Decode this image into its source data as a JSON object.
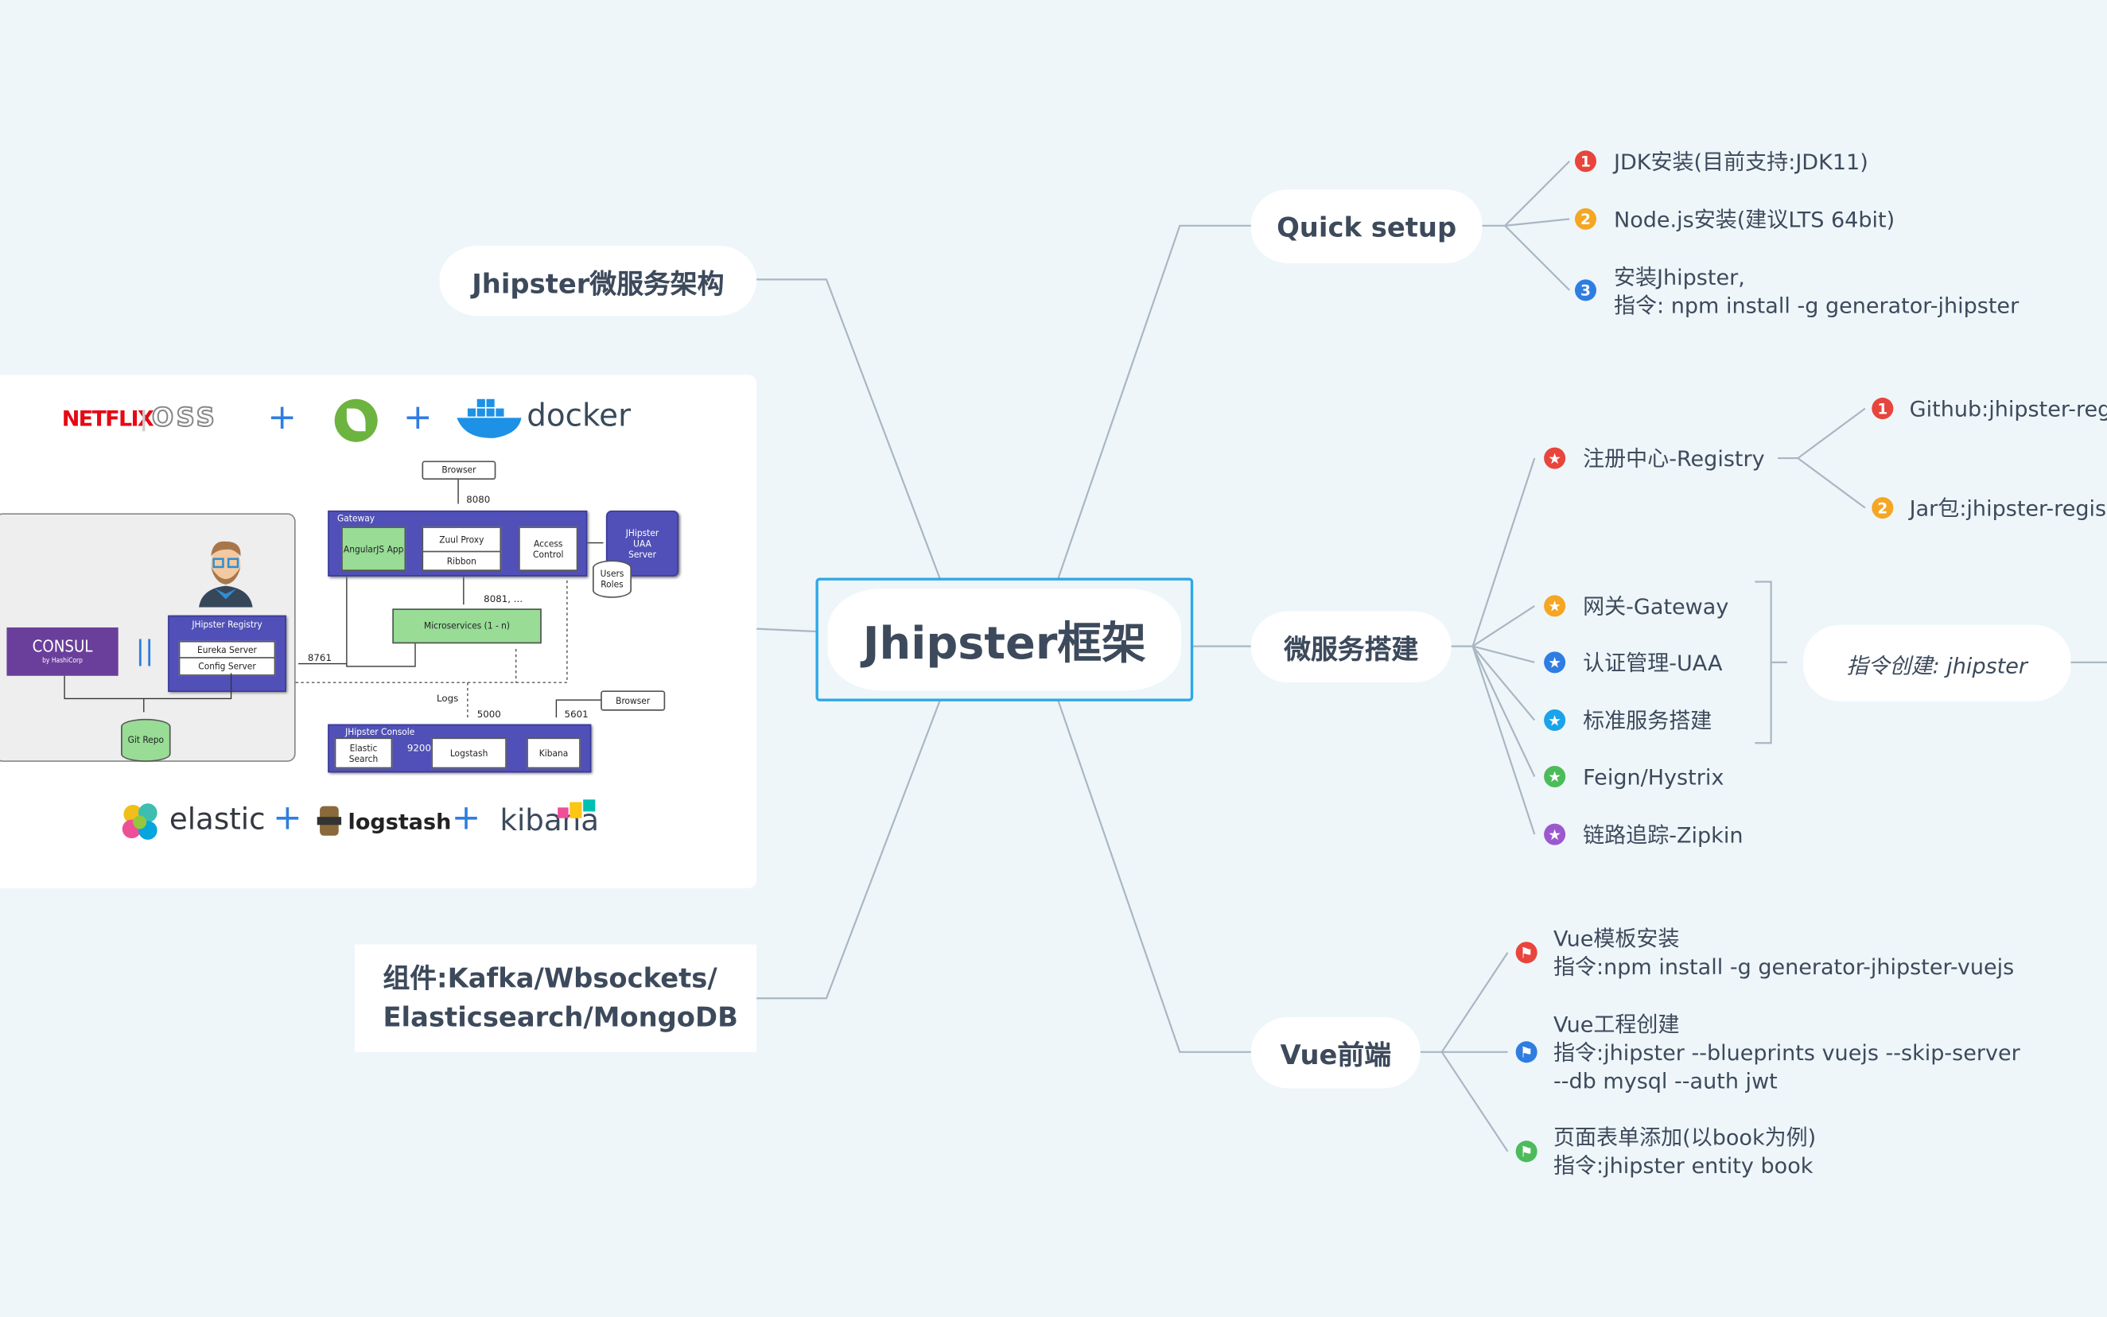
{
  "colors": {
    "background": "#eef6fa",
    "central_border": "#2ea8e6",
    "line": "#a9b7c3",
    "red": "#e8453c",
    "orange": "#f5a623",
    "blue": "#2f7de1",
    "cyan": "#1aa3e8",
    "green": "#4cbb5a",
    "purple": "#9b59d0",
    "diagram_blue": "#5050b8",
    "diagram_green": "#98dc96"
  },
  "central": {
    "title": "Jhipster框架"
  },
  "left": {
    "architecture": {
      "title": "Jhipster微服务架构"
    },
    "components": {
      "line1": "组件:Kafka/Wbsockets/",
      "line2": "Elasticsearch/MongoDB"
    }
  },
  "diagram": {
    "logos": {
      "netflix": "NETFLIX",
      "oss": "OSS",
      "docker": "docker",
      "elastic": "elastic",
      "logstash": "logstash",
      "kibana": "kibana",
      "consul": "CONSUL",
      "hashicorp": "by HashiCorp"
    },
    "browser": "Browser",
    "port_8080": "8080",
    "gateway": "Gateway",
    "angular": "AngularJS App",
    "zuul": "Zuul Proxy",
    "ribbon": "Ribbon",
    "access": "Access Control",
    "uaa": "JHipster UAA Server",
    "users_roles": "Users Roles",
    "port_8081": "8081, ...",
    "microservices": "Microservices  (1 - n)",
    "registry": "JHipster Registry",
    "eureka": "Eureka Server",
    "config": "Config Server",
    "git": "Git Repo",
    "port_8761": "8761",
    "logs": "Logs",
    "port_5000": "5000",
    "port_5601": "5601",
    "browser2": "Browser",
    "console": "JHipster Console",
    "elastic_search": "Elastic Search",
    "port_9200": "9200",
    "logstash_box": "Logstash",
    "kibana_box": "Kibana"
  },
  "quick_setup": {
    "title": "Quick setup",
    "items": [
      {
        "icon": "number-1-icon",
        "num": "1",
        "color": "#e8453c",
        "lines": [
          "JDK安装(目前支持:JDK11)"
        ]
      },
      {
        "icon": "number-2-icon",
        "num": "2",
        "color": "#f5a623",
        "lines": [
          "Node.js安装(建议LTS 64bit)"
        ]
      },
      {
        "icon": "number-3-icon",
        "num": "3",
        "color": "#2f7de1",
        "lines": [
          "安装Jhipster,",
          "指令: npm install -g generator-jhipster"
        ]
      }
    ]
  },
  "microservice": {
    "title": "微服务搭建",
    "registry": {
      "label": "注册中心-Registry",
      "children": [
        {
          "num": "1",
          "color": "#e8453c",
          "label": "Github:jhipster-reg"
        },
        {
          "num": "2",
          "color": "#f5a623",
          "label": "Jar包:jhipster-regis"
        }
      ]
    },
    "items": [
      {
        "color": "#f5a623",
        "label": "网关-Gateway"
      },
      {
        "color": "#2f7de1",
        "label": "认证管理-UAA"
      },
      {
        "color": "#1aa3e8",
        "label": "标准服务搭建"
      },
      {
        "color": "#4cbb5a",
        "label": "Feign/Hystrix"
      },
      {
        "color": "#9b59d0",
        "label": "链路追踪-Zipkin"
      }
    ],
    "summary": "指令创建: jhipster"
  },
  "vue": {
    "title": "Vue前端",
    "items": [
      {
        "color": "#e8453c",
        "lines": [
          "Vue模板安装",
          "指令:npm install -g generator-jhipster-vuejs"
        ]
      },
      {
        "color": "#2f7de1",
        "lines": [
          "Vue工程创建",
          "指令:jhipster --blueprints vuejs --skip-server",
          "--db mysql --auth jwt"
        ]
      },
      {
        "color": "#4cbb5a",
        "lines": [
          "页面表单添加(以book为例)",
          "指令:jhipster entity book"
        ]
      }
    ]
  }
}
